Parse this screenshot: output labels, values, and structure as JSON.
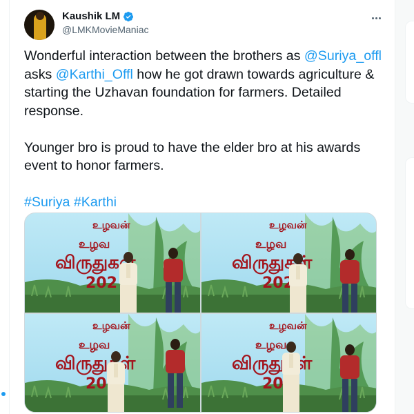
{
  "tweet": {
    "author": {
      "name": "Kaushik LM",
      "handle": "@LMKMovieManiac",
      "verified": true
    },
    "paragraphs": [
      [
        {
          "text": "Wonderful interaction between the brothers as ",
          "type": "text"
        },
        {
          "text": "@Suriya_offl",
          "type": "mention"
        },
        {
          "text": " asks ",
          "type": "text"
        },
        {
          "text": "@Karthi_Offl",
          "type": "mention"
        },
        {
          "text": " how he got drawn towards agriculture & starting the Uzhavan foundation for farmers. Detailed response.",
          "type": "text"
        }
      ],
      [
        {
          "text": "Younger bro is proud to have the elder bro at his awards event to honor farmers.",
          "type": "text"
        }
      ],
      [
        {
          "text": "#Suriya",
          "type": "hashtag"
        },
        {
          "text": " ",
          "type": "text"
        },
        {
          "text": "#Karthi",
          "type": "hashtag"
        }
      ]
    ],
    "media": {
      "photo_count": 4,
      "banner_text": {
        "logo": "உழவன்",
        "line1": "உழவ",
        "line2": "விருதுகள்",
        "year": "202"
      }
    }
  },
  "colors": {
    "link": "#1d9bf0",
    "text": "#0f1419",
    "secondary": "#536471",
    "stage_bg": "#a9e2f4",
    "logo_red": "#a3151d"
  },
  "icons": {
    "verified": "verified-badge-icon",
    "more": "more-options-icon"
  }
}
